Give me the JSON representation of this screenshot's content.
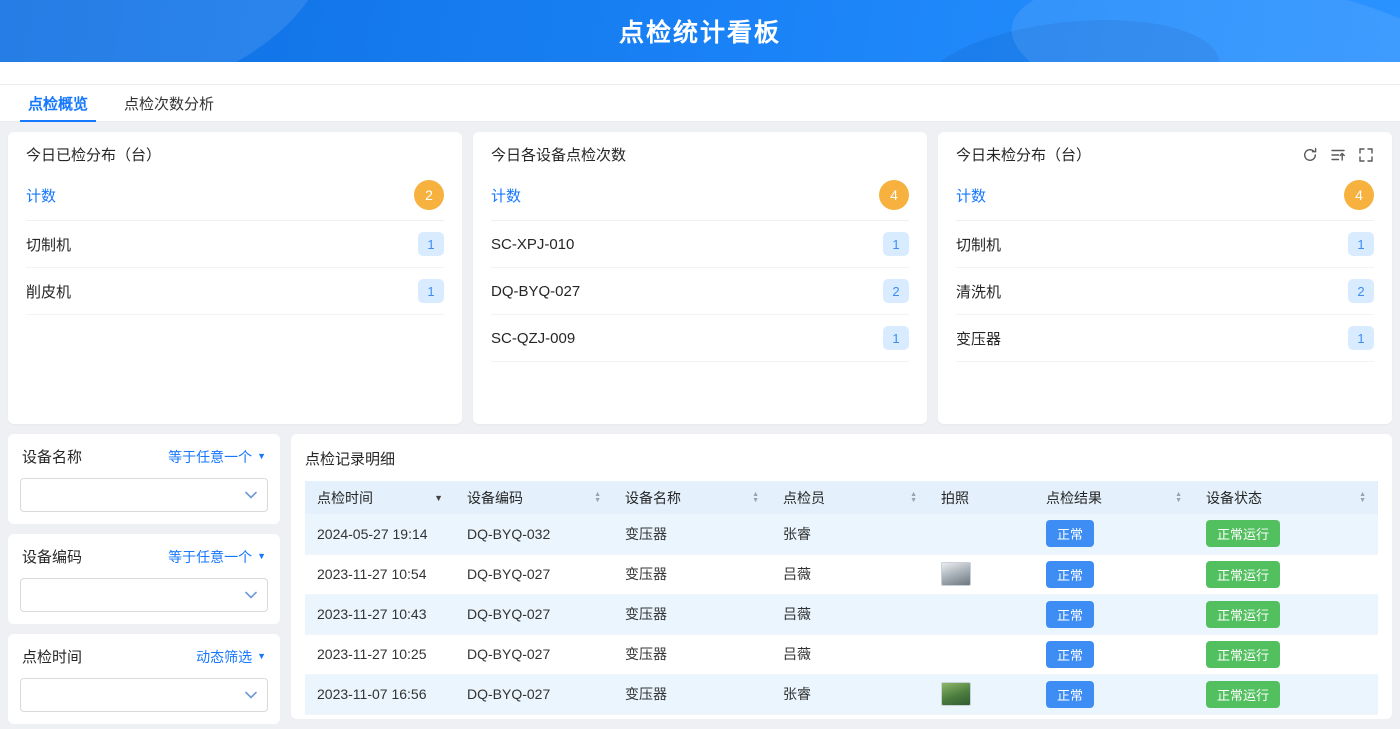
{
  "header": {
    "title": "点检统计看板"
  },
  "tabs": {
    "overview": "点检概览",
    "analysis": "点检次数分析"
  },
  "cards": [
    {
      "title": "今日已检分布（台）",
      "count_label": "计数",
      "count_value": "2",
      "items": [
        {
          "label": "切制机",
          "value": "1"
        },
        {
          "label": "削皮机",
          "value": "1"
        }
      ]
    },
    {
      "title": "今日各设备点检次数",
      "count_label": "计数",
      "count_value": "4",
      "items": [
        {
          "label": "SC-XPJ-010",
          "value": "1"
        },
        {
          "label": "DQ-BYQ-027",
          "value": "2"
        },
        {
          "label": "SC-QZJ-009",
          "value": "1"
        }
      ]
    },
    {
      "title": "今日未检分布（台）",
      "count_label": "计数",
      "count_value": "4",
      "items": [
        {
          "label": "切制机",
          "value": "1"
        },
        {
          "label": "清洗机",
          "value": "2"
        },
        {
          "label": "变压器",
          "value": "1"
        }
      ]
    }
  ],
  "filters": [
    {
      "label": "设备名称",
      "operator": "等于任意一个"
    },
    {
      "label": "设备编码",
      "operator": "等于任意一个"
    },
    {
      "label": "点检时间",
      "operator": "动态筛选"
    }
  ],
  "table": {
    "title": "点检记录明细",
    "columns": [
      "点检时间",
      "设备编码",
      "设备名称",
      "点检员",
      "拍照",
      "点检结果",
      "设备状态"
    ],
    "rows": [
      {
        "time": "2024-05-27 19:14",
        "code": "DQ-BYQ-032",
        "name": "变压器",
        "inspector": "张睿",
        "has_photo": false,
        "result": "正常",
        "status": "正常运行"
      },
      {
        "time": "2023-11-27 10:54",
        "code": "DQ-BYQ-027",
        "name": "变压器",
        "inspector": "吕薇",
        "has_photo": true,
        "result": "正常",
        "status": "正常运行"
      },
      {
        "time": "2023-11-27 10:43",
        "code": "DQ-BYQ-027",
        "name": "变压器",
        "inspector": "吕薇",
        "has_photo": false,
        "result": "正常",
        "status": "正常运行"
      },
      {
        "time": "2023-11-27 10:25",
        "code": "DQ-BYQ-027",
        "name": "变压器",
        "inspector": "吕薇",
        "has_photo": false,
        "result": "正常",
        "status": "正常运行"
      },
      {
        "time": "2023-11-07 16:56",
        "code": "DQ-BYQ-027",
        "name": "变压器",
        "inspector": "张睿",
        "has_photo": true,
        "result": "正常",
        "status": "正常运行"
      }
    ]
  },
  "icons": {
    "sort_up": "▲",
    "sort_down": "▼",
    "caret_down": "▼",
    "card_action_names": [
      "refresh-icon",
      "list-sort-icon",
      "fullscreen-icon"
    ]
  },
  "colors": {
    "banner_blue": "#1a83f7",
    "accent_blue": "#1677ff",
    "count_badge_orange": "#f6b13f",
    "item_badge_bg": "#d9ecff",
    "item_badge_text": "#3d8df5",
    "result_badge_blue": "#3d8df5",
    "status_badge_green": "#53c05f",
    "table_header_bg": "#e4f1fc",
    "row_alt_bg": "#eaf5fd"
  }
}
